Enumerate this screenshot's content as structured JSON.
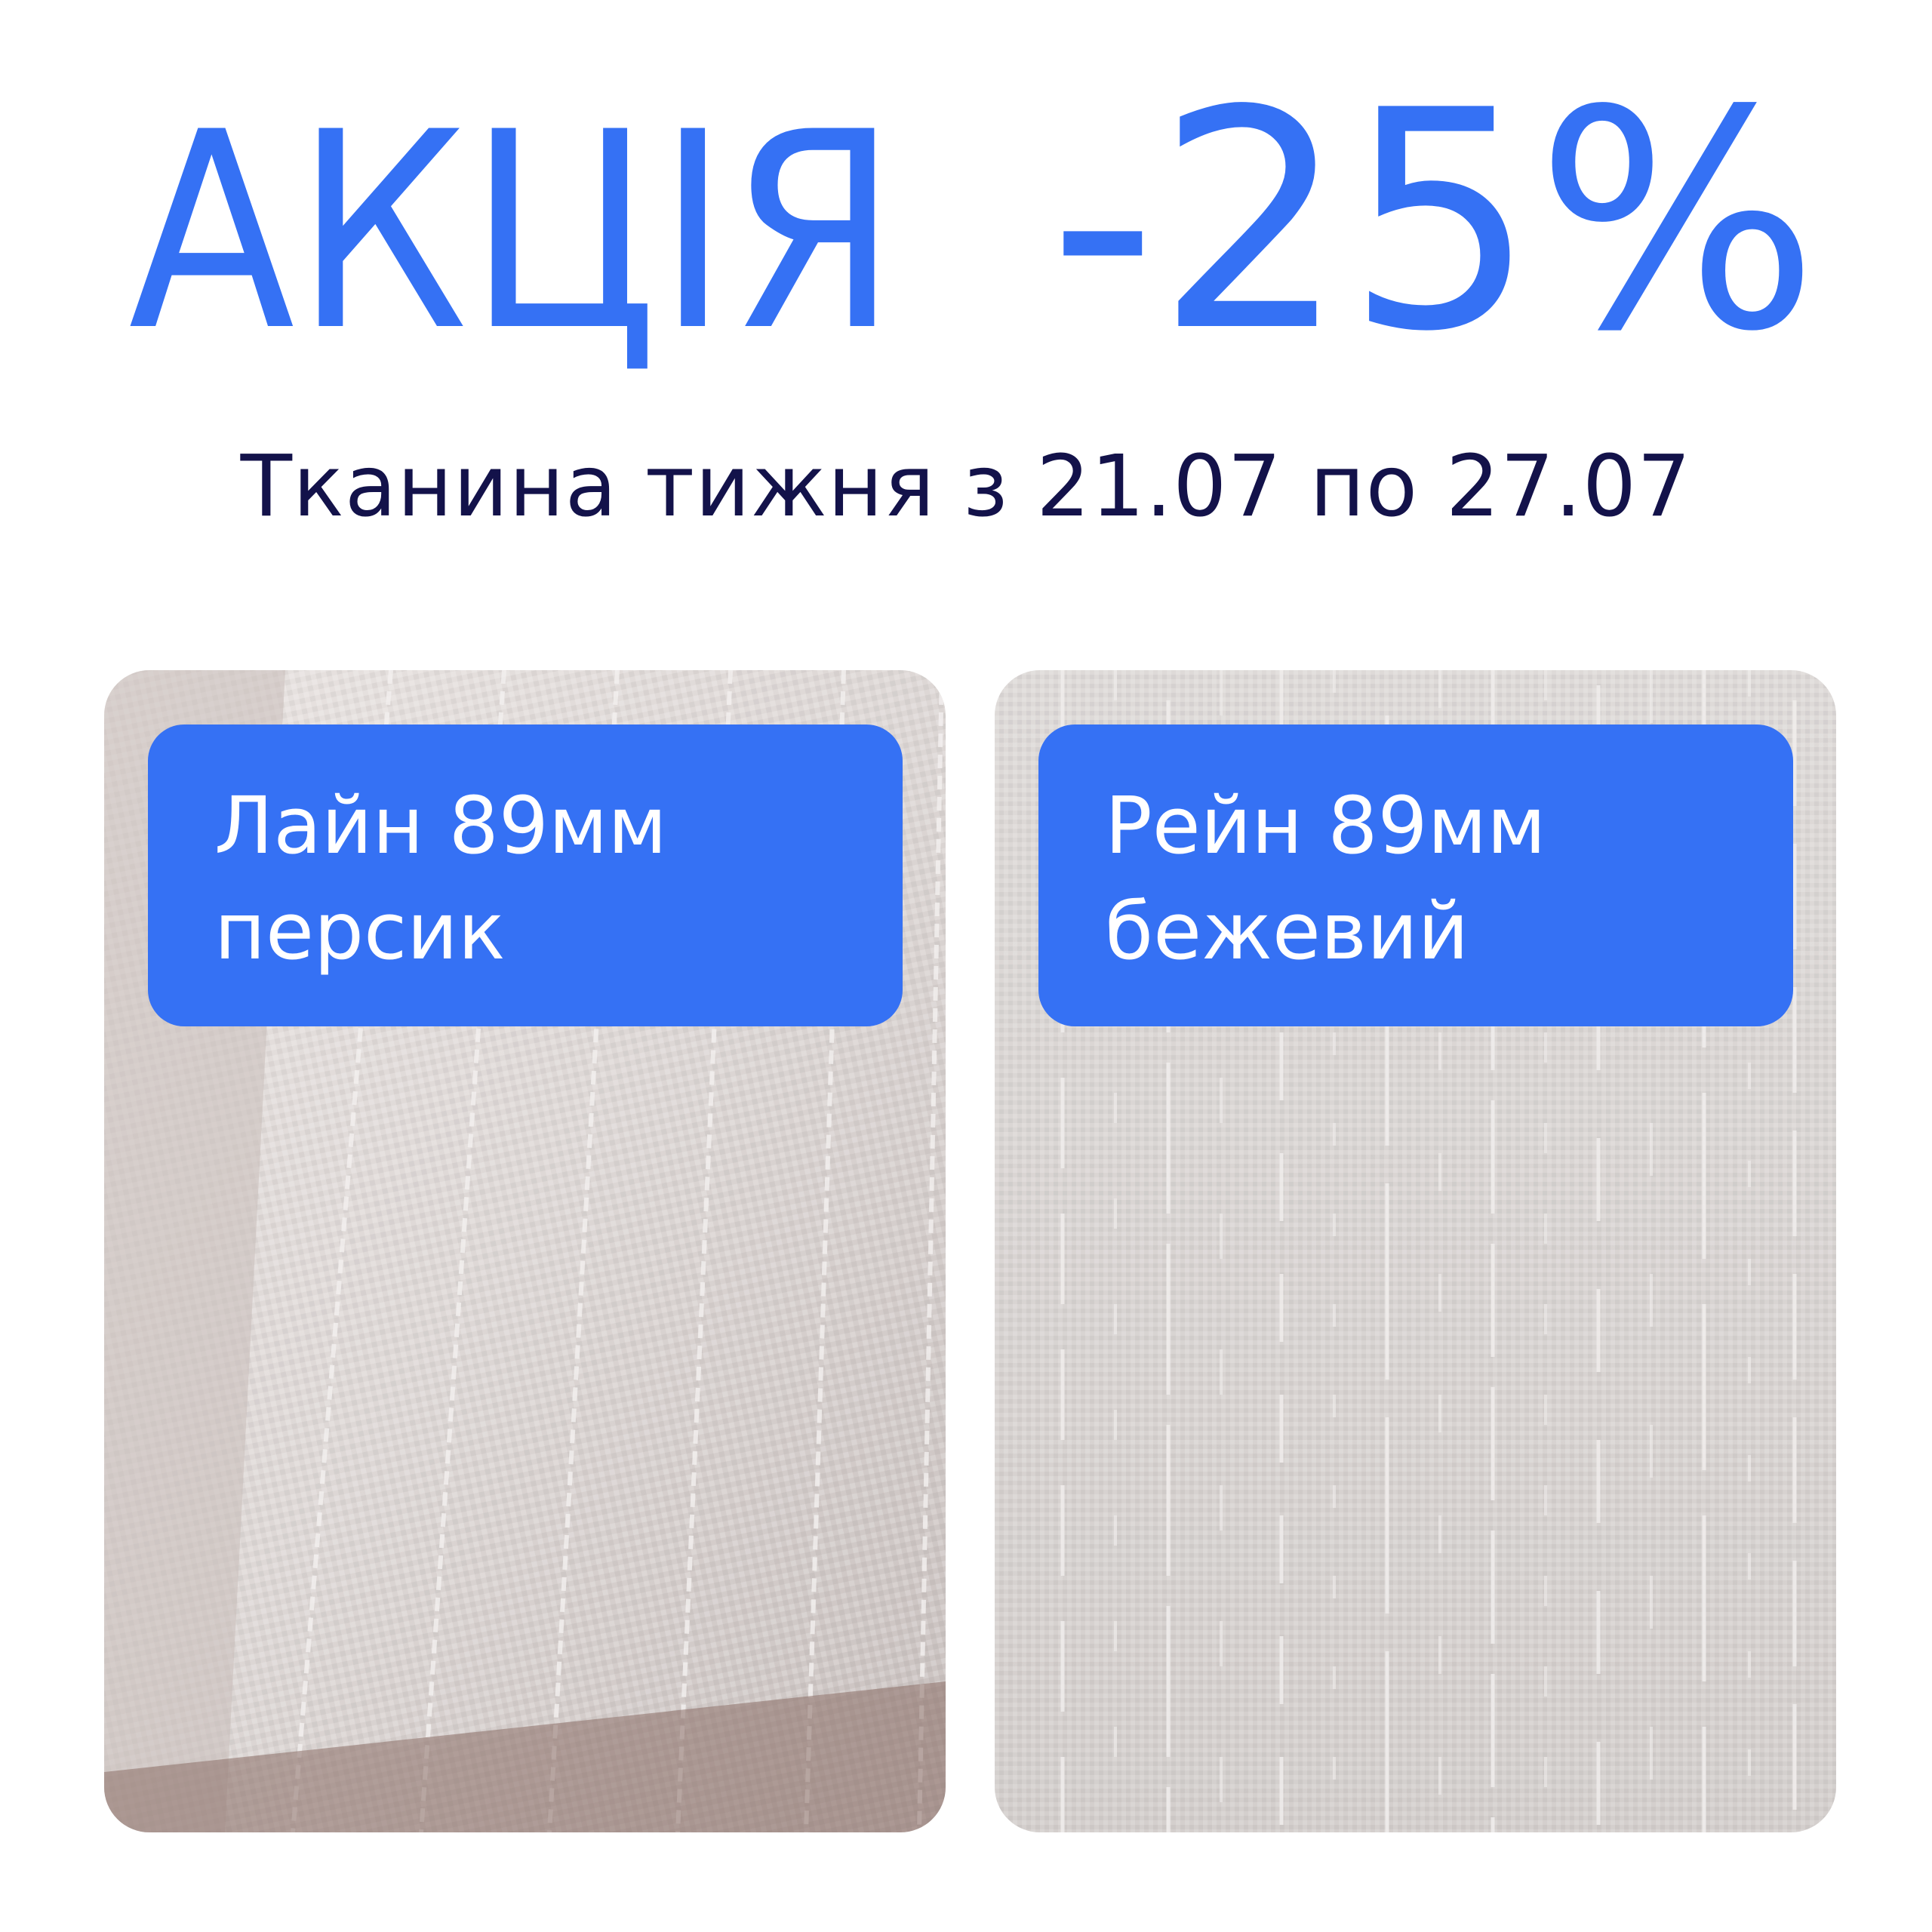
{
  "promo": {
    "title": "АКЦІЯ",
    "discount": "-25%",
    "subtitle": "Тканина тижня з 21.07 по 27.07"
  },
  "colors": {
    "accent": "#3571f4",
    "subtitle": "#13124a",
    "label_text": "#ffffff"
  },
  "products": [
    {
      "name_line1": "Лайн 89мм",
      "name_line2": "персик"
    },
    {
      "name_line1": "Рейн 89мм",
      "name_line2": "бежевий"
    }
  ]
}
